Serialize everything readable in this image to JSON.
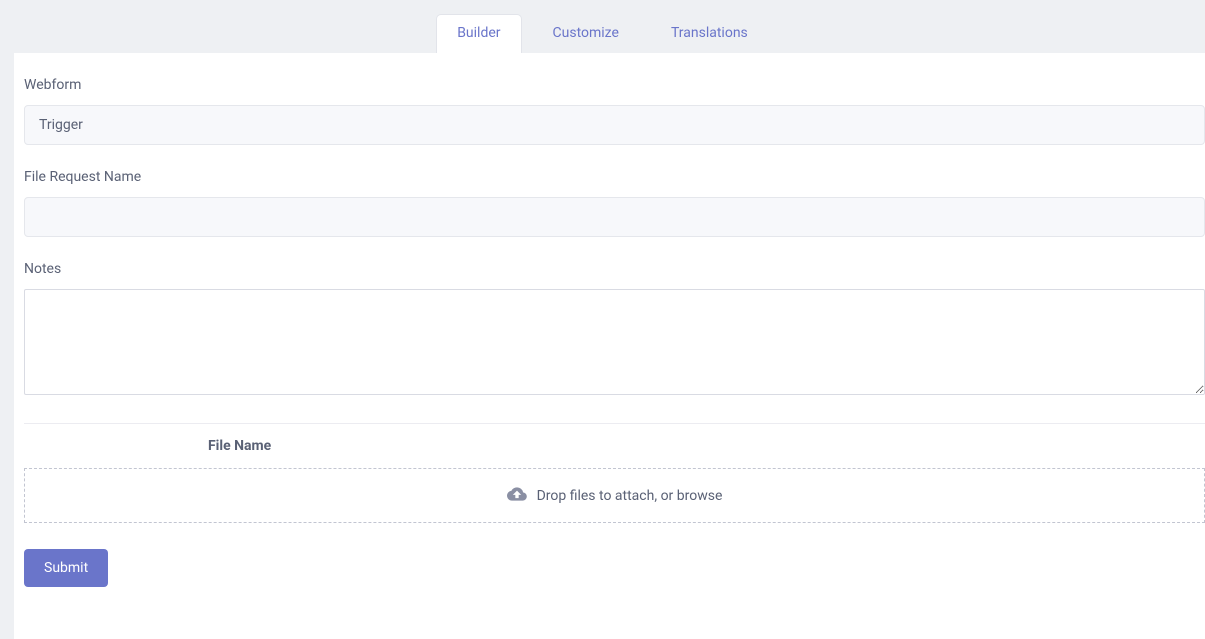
{
  "tabs": {
    "builder": "Builder",
    "customize": "Customize",
    "translations": "Translations"
  },
  "form": {
    "webform_label": "Webform",
    "webform_value": "Trigger",
    "file_request_label": "File Request Name",
    "file_request_value": "",
    "notes_label": "Notes",
    "notes_value": ""
  },
  "files": {
    "header": "File Name",
    "dropzone_text": "Drop files to attach, or browse"
  },
  "submit_label": "Submit"
}
